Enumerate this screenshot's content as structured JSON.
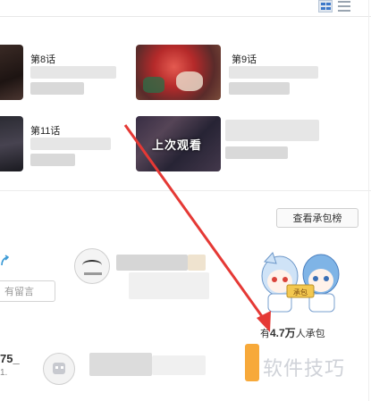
{
  "episodes": [
    {
      "title": "第8话"
    },
    {
      "title": "第9话"
    },
    {
      "title": "第11话"
    },
    {
      "title": "",
      "overlay": "上次观看"
    }
  ],
  "rank_button": {
    "label": "查看承包榜"
  },
  "comment": {
    "placeholder": "有留言"
  },
  "sponsor": {
    "prefix": "有",
    "count": "4.7万",
    "suffix": "人承包",
    "sign": "承包"
  },
  "user": {
    "name": "75_",
    "sub": "1."
  },
  "watermark": {
    "text": "软件技巧"
  },
  "colors": {
    "accent": "#f7a93a",
    "link": "#3d78c9",
    "arrow": "#e53935"
  },
  "icons": [
    "grid-view-icon",
    "list-view-icon",
    "share-icon",
    "robot-avatar-icon"
  ]
}
